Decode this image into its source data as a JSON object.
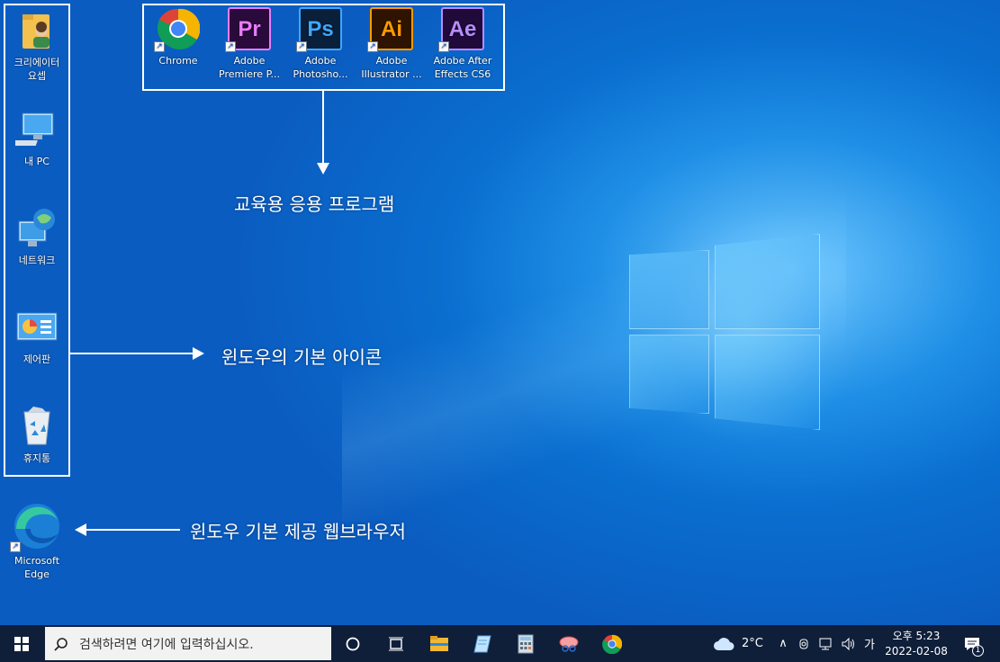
{
  "desktop": {
    "left_icons": [
      {
        "label": "크리에이터\n요셉",
        "icon": "user-folder-icon"
      },
      {
        "label": "내 PC",
        "icon": "computer-icon"
      },
      {
        "label": "네트워크",
        "icon": "network-icon"
      },
      {
        "label": "제어판",
        "icon": "control-panel-icon"
      },
      {
        "label": "휴지통",
        "icon": "recycle-bin-icon"
      }
    ],
    "top_icons": [
      {
        "label": "Chrome",
        "icon": "chrome-icon"
      },
      {
        "label": "Adobe\nPremiere P...",
        "icon": "premiere-icon",
        "glyph": "Pr"
      },
      {
        "label": "Adobe\nPhotosho...",
        "icon": "photoshop-icon",
        "glyph": "Ps"
      },
      {
        "label": "Adobe\nIllustrator ...",
        "icon": "illustrator-icon",
        "glyph": "Ai"
      },
      {
        "label": "Adobe After\nEffects CS6",
        "icon": "after-effects-icon",
        "glyph": "Ae"
      }
    ],
    "edge_icon": {
      "label": "Microsoft\nEdge",
      "icon": "edge-icon"
    },
    "shortcut_glyph": "↗"
  },
  "annotations": {
    "edu_programs": "교육용 응용 프로그램",
    "basic_icons": "윈도우의 기본 아이콘",
    "browser": "윈도우 기본 제공 웹브라우저"
  },
  "taskbar": {
    "search_placeholder": "검색하려면 여기에 입력하십시오.",
    "weather": "2°C",
    "ime": "가",
    "time": "오후 5:23",
    "date": "2022-02-08",
    "notification_count": "1"
  },
  "colors": {
    "taskbar": "#0f1f3a",
    "premiere_bg": "#2a0a3a",
    "premiere_fg": "#e77cff",
    "photoshop_bg": "#0a1f3a",
    "photoshop_fg": "#3ea8ff",
    "illustrator_bg": "#2e1400",
    "illustrator_fg": "#ff9a00",
    "after_effects_bg": "#1f0a3a",
    "after_effects_fg": "#b68cff"
  }
}
